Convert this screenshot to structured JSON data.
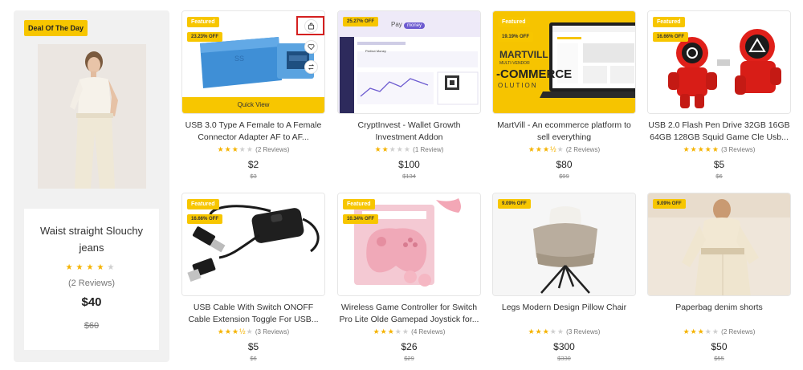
{
  "deal": {
    "badge": "Deal Of The Day",
    "title": "Waist straight Slouchy jeans",
    "reviews": "(2 Reviews)",
    "price": "$40",
    "old_price": "$60",
    "rating": 4
  },
  "quick_view": "Quick View",
  "products": [
    {
      "featured": "Featured",
      "off": "23.23% OFF",
      "name": "USB 3.0 Type A Female to A Female Connector Adapter AF to AF...",
      "rating": 3,
      "reviews": "(2 Reviews)",
      "price": "$2",
      "old_price": "$3"
    },
    {
      "featured": "",
      "off": "25.27% OFF",
      "name": "CryptInvest - Wallet Growth Investment Addon",
      "rating": 2,
      "reviews": "(1 Review)",
      "price": "$100",
      "old_price": "$134",
      "screen_brand": "Pay",
      "screen_brand_tag": "money",
      "screen_title": "Perfect Money"
    },
    {
      "featured": "Featured",
      "off": "19.19% OFF",
      "name": "MartVill - An ecommerce platform to sell everything",
      "rating": 3.5,
      "reviews": "(2 Reviews)",
      "price": "$80",
      "old_price": "$99",
      "banner_top": "MARTVILL",
      "banner_mid": "-COMMERCE",
      "banner_bottom": "OLUTION",
      "banner_small": "MULTI-VENDOR"
    },
    {
      "featured": "Featured",
      "off": "16.66% OFF",
      "name": "USB 2.0 Flash Pen Drive 32GB 16GB 64GB 128GB Squid Game Cle Usb...",
      "rating": 5,
      "reviews": "(3 Reviews)",
      "price": "$5",
      "old_price": "$6"
    },
    {
      "featured": "Featured",
      "off": "16.66% OFF",
      "name": "USB Cable With Switch ONOFF Cable Extension Toggle For USB...",
      "rating": 3.5,
      "reviews": "(3 Reviews)",
      "price": "$5",
      "old_price": "$6"
    },
    {
      "featured": "Featured",
      "off": "10.34% OFF",
      "name": "Wireless Game Controller for Switch Pro Lite Olde Gamepad Joystick for...",
      "rating": 3,
      "reviews": "(4 Reviews)",
      "price": "$26",
      "old_price": "$29"
    },
    {
      "featured": "",
      "off": "9.09% OFF",
      "name": "Legs Modern Design Pillow Chair",
      "rating": 3,
      "reviews": "(3 Reviews)",
      "price": "$300",
      "old_price": "$330"
    },
    {
      "featured": "",
      "off": "9.09% OFF",
      "name": "Paperbag denim shorts",
      "rating": 3,
      "reviews": "(2 Reviews)",
      "price": "$50",
      "old_price": "$55"
    }
  ],
  "colors": {
    "accent": "#f7c600",
    "star": "#f5b301",
    "highlight": "#d42020"
  },
  "icons": [
    "bag-icon",
    "heart-icon",
    "compare-icon"
  ]
}
